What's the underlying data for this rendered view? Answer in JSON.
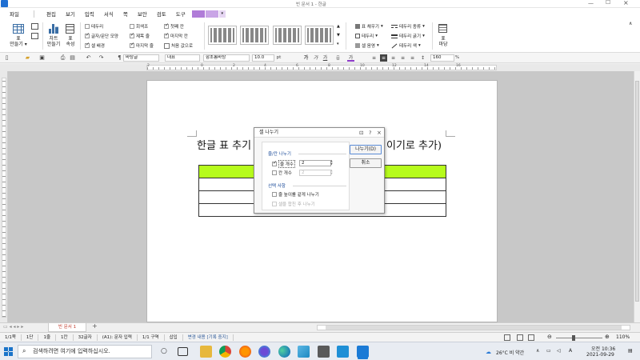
{
  "window": {
    "title": "빈 문서 1 - 한글"
  },
  "menu": {
    "items": [
      "파일",
      "편집",
      "보기",
      "입력",
      "서식",
      "쪽",
      "보안",
      "검토",
      "도구"
    ]
  },
  "ribbon": {
    "table_button": "표\n만들기",
    "chart_button": "차트\n만들기",
    "props_button": "표\n속성",
    "checks": [
      {
        "label": "테두리",
        "on": false
      },
      {
        "label": "글자/문단 모양",
        "on": true
      },
      {
        "label": "셀 배경",
        "on": true
      },
      {
        "label": "회색조",
        "on": false
      },
      {
        "label": "제목 줄",
        "on": true
      },
      {
        "label": "마지막 줄",
        "on": true
      },
      {
        "label": "첫째 칸",
        "on": true
      },
      {
        "label": "마지막 칸",
        "on": true
      },
      {
        "label": "처음 값으로",
        "on": false
      }
    ],
    "right_items": [
      "표 채우기",
      "테두리",
      "셀 음영",
      "테두리 종류",
      "테두리 굵기",
      "테두리 색"
    ],
    "table_style_button": "표\n마당"
  },
  "toolbar": {
    "style": "바탕글",
    "font_kind": "대표",
    "font": "함초롬바탕",
    "size": "10.0",
    "size_unit": "pt",
    "bold": "가",
    "italic": "가",
    "underline": "가",
    "zoom": "160",
    "zoom_unit": "%"
  },
  "ruler": {
    "marks": [
      "2",
      "0",
      "2",
      "4",
      "6",
      "8",
      "10",
      "12",
      "14",
      "16"
    ]
  },
  "document": {
    "heading_left": "한글 표 추기",
    "heading_right": "이기로 추가)"
  },
  "dialog": {
    "title": "셀 나누기",
    "help": "?",
    "close": "×",
    "group1": "줄/칸 나누기",
    "row_label": "줄 개수",
    "row_value": "2",
    "col_label": "칸 개수",
    "col_value": "2",
    "group2": "선택 사항",
    "opt1": "줄 높이를 같게 나누기",
    "opt2": "셀을 합친 후 나누기",
    "ok": "나누기(D)",
    "cancel": "취소"
  },
  "tabs": {
    "doc": "빈 문서 1",
    "add": "+"
  },
  "status": [
    "1/1쪽",
    "1단",
    "1줄",
    "1칸",
    "32글자",
    "(A1): 문자 입력",
    "1/1 구역",
    "삽입",
    "변경 내용 [기록 중지]"
  ],
  "status_zoom": "110%",
  "taskbar": {
    "search_placeholder": "검색하려면 여기에 입력하십시오.",
    "weather": "26°C 비 약간",
    "time": "오전 10:36",
    "date": "2021-09-29"
  },
  "colors": {
    "header_row": "#b6fb1c",
    "accent": "#2b5797"
  }
}
